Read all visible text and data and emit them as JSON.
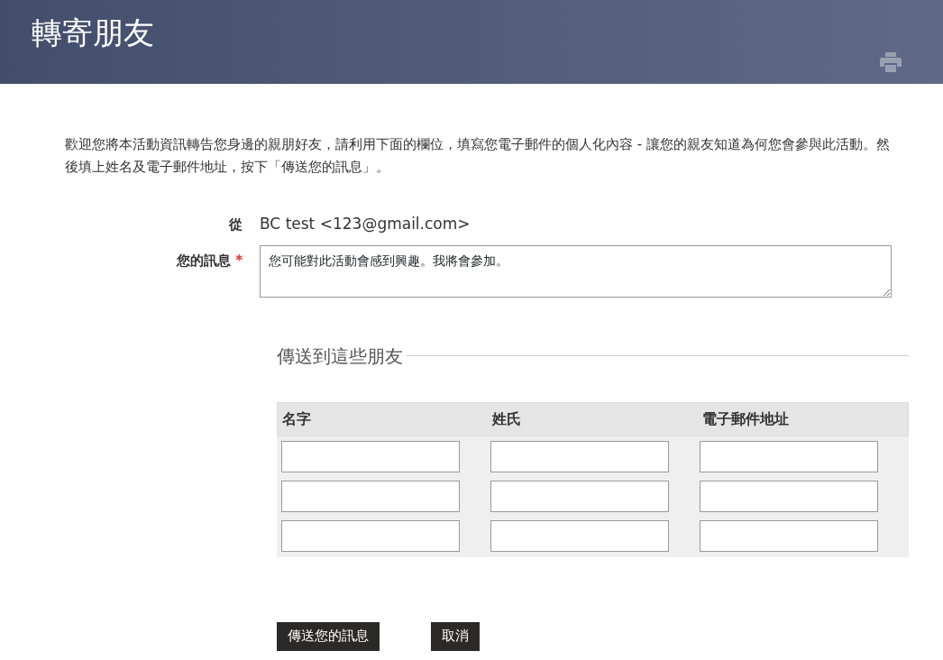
{
  "header": {
    "title": "轉寄朋友"
  },
  "intro": "歡迎您將本活動資訊轉告您身邊的親朋好友，請利用下面的欄位，填寫您電子郵件的個人化內容 - 讓您的親友知道為何您會參與此活動。然後填上姓名及電子郵件地址，按下「傳送您的訊息」。",
  "from": {
    "label": "從",
    "value": "BC test <123@gmail.com>"
  },
  "message": {
    "label": "您的訊息",
    "required": true,
    "required_mark": "*",
    "value": "您可能對此活動會感到興趣。我將會參加。"
  },
  "friends": {
    "legend": "傳送到這些朋友",
    "columns": [
      "名字",
      "姓氏",
      "電子郵件地址"
    ],
    "rows": [
      {
        "cells": [
          {
            "kind": "input"
          },
          {
            "kind": "input"
          },
          {
            "kind": "input"
          }
        ]
      },
      {
        "cells": [
          {
            "kind": "input"
          },
          {
            "kind": "input"
          },
          {
            "kind": "input"
          }
        ]
      },
      {
        "cells": [
          {
            "kind": "input"
          },
          {
            "kind": "input"
          },
          {
            "kind": "input"
          }
        ]
      }
    ]
  },
  "buttons": [
    "傳送您的訊息",
    "取消"
  ]
}
